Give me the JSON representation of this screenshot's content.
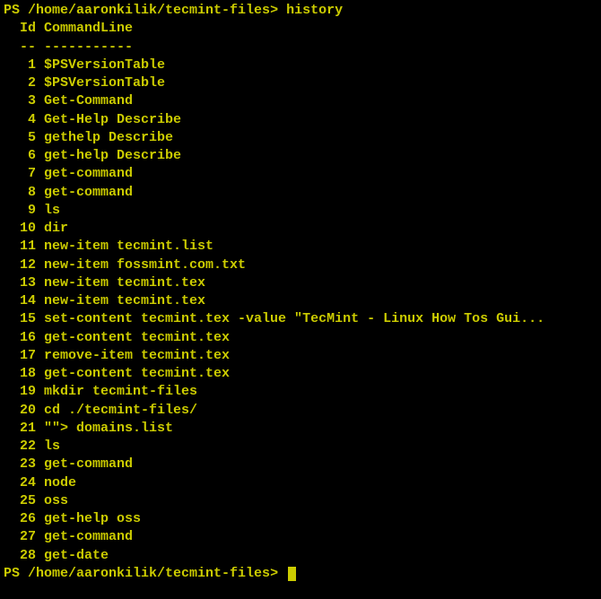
{
  "prompt1": {
    "prefix": "PS ",
    "path": "/home/aaronkilik/tecmint-files",
    "sep": "> ",
    "command": "history"
  },
  "blank1": "",
  "header": {
    "id": "Id",
    "cmd": "CommandLine"
  },
  "divider": {
    "id": "--",
    "cmd": "-----------"
  },
  "history": [
    {
      "id": "1",
      "cmd": "$PSVersionTable"
    },
    {
      "id": "2",
      "cmd": "$PSVersionTable"
    },
    {
      "id": "3",
      "cmd": "Get-Command"
    },
    {
      "id": "4",
      "cmd": "Get-Help Describe"
    },
    {
      "id": "5",
      "cmd": "gethelp Describe"
    },
    {
      "id": "6",
      "cmd": "get-help Describe"
    },
    {
      "id": "7",
      "cmd": "get-command"
    },
    {
      "id": "8",
      "cmd": "get-command"
    },
    {
      "id": "9",
      "cmd": "ls"
    },
    {
      "id": "10",
      "cmd": "dir"
    },
    {
      "id": "11",
      "cmd": "new-item tecmint.list"
    },
    {
      "id": "12",
      "cmd": "new-item fossmint.com.txt"
    },
    {
      "id": "13",
      "cmd": "new-item tecmint.tex"
    },
    {
      "id": "14",
      "cmd": "new-item tecmint.tex"
    },
    {
      "id": "15",
      "cmd": "set-content tecmint.tex -value \"TecMint - Linux How Tos Gui..."
    },
    {
      "id": "16",
      "cmd": "get-content tecmint.tex"
    },
    {
      "id": "17",
      "cmd": "remove-item tecmint.tex"
    },
    {
      "id": "18",
      "cmd": "get-content tecmint.tex"
    },
    {
      "id": "19",
      "cmd": "mkdir tecmint-files"
    },
    {
      "id": "20",
      "cmd": "cd ./tecmint-files/"
    },
    {
      "id": "21",
      "cmd": "\"\"> domains.list"
    },
    {
      "id": "22",
      "cmd": "ls"
    },
    {
      "id": "23",
      "cmd": "get-command"
    },
    {
      "id": "24",
      "cmd": "node"
    },
    {
      "id": "25",
      "cmd": "oss"
    },
    {
      "id": "26",
      "cmd": "get-help oss"
    },
    {
      "id": "27",
      "cmd": "get-command"
    },
    {
      "id": "28",
      "cmd": "get-date"
    }
  ],
  "blank2": "",
  "blank3": "",
  "prompt2": {
    "prefix": "PS ",
    "path": "/home/aaronkilik/tecmint-files",
    "sep": "> "
  }
}
